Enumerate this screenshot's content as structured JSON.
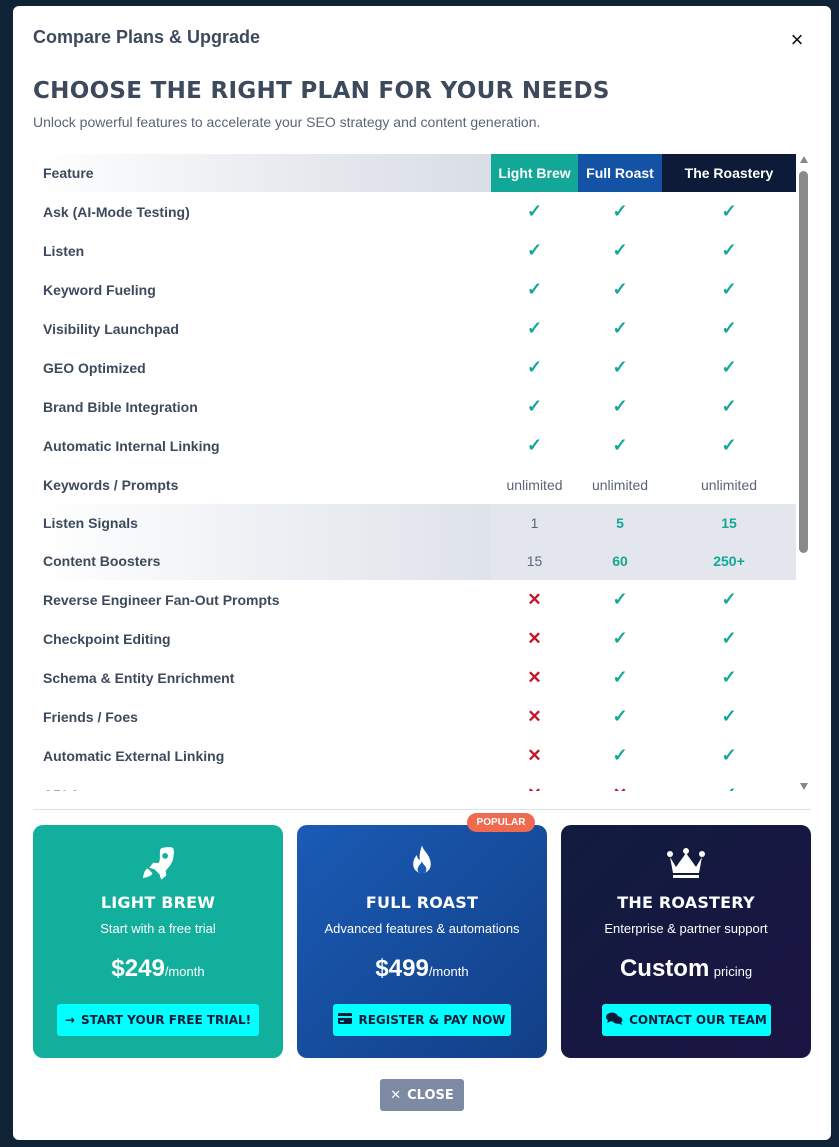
{
  "modal": {
    "title": "Compare Plans & Upgrade",
    "close_glyph": "×",
    "heading": "Choose the right plan for your needs",
    "subtitle": "Unlock powerful features to accelerate your SEO strategy and content generation."
  },
  "table": {
    "headers": {
      "feature": "Feature",
      "light_brew": "Light Brew",
      "full_roast": "Full Roast",
      "roastery": "The Roastery"
    },
    "rows": [
      {
        "feature": "Ask (AI-Mode Testing)",
        "values": [
          "check",
          "check",
          "check"
        ]
      },
      {
        "feature": "Listen",
        "values": [
          "check",
          "check",
          "check"
        ]
      },
      {
        "feature": "Keyword Fueling",
        "values": [
          "check",
          "check",
          "check"
        ]
      },
      {
        "feature": "Visibility Launchpad",
        "values": [
          "check",
          "check",
          "check"
        ]
      },
      {
        "feature": "GEO Optimized",
        "values": [
          "check",
          "check",
          "check"
        ]
      },
      {
        "feature": "Brand Bible Integration",
        "values": [
          "check",
          "check",
          "check"
        ]
      },
      {
        "feature": "Automatic Internal Linking",
        "values": [
          "check",
          "check",
          "check"
        ]
      },
      {
        "feature": "Keywords / Prompts",
        "values": [
          "unlimited",
          "unlimited",
          "unlimited"
        ]
      },
      {
        "feature": "Listen Signals",
        "values": [
          "1",
          "5",
          "15"
        ]
      },
      {
        "feature": "Content Boosters",
        "values": [
          "15",
          "60",
          "250+"
        ]
      },
      {
        "feature": "Reverse Engineer Fan-Out Prompts",
        "values": [
          "cross",
          "check",
          "check"
        ]
      },
      {
        "feature": "Checkpoint Editing",
        "values": [
          "cross",
          "check",
          "check"
        ]
      },
      {
        "feature": "Schema & Entity Enrichment",
        "values": [
          "cross",
          "check",
          "check"
        ]
      },
      {
        "feature": "Friends / Foes",
        "values": [
          "cross",
          "check",
          "check"
        ]
      },
      {
        "feature": "Automatic External Linking",
        "values": [
          "cross",
          "check",
          "check"
        ]
      },
      {
        "feature": "API Access",
        "values": [
          "cross",
          "cross",
          "check"
        ]
      }
    ],
    "check_glyph": "✓",
    "cross_glyph": "✕"
  },
  "cards": {
    "light_brew": {
      "icon": "rocket-icon",
      "name": "Light Brew",
      "desc": "Start with a free trial",
      "price": "$249",
      "price_suffix": "/month",
      "button_icon": "arrow-right-icon",
      "button_glyph": "→",
      "button": "Start your free trial!"
    },
    "full_roast": {
      "badge": "POPULAR",
      "icon": "fire-icon",
      "name": "Full Roast",
      "desc": "Advanced features & automations",
      "price": "$499",
      "price_suffix": "/month",
      "button_icon": "credit-card-icon",
      "button": "Register & Pay Now"
    },
    "roastery": {
      "icon": "crown-icon",
      "name": "The Roastery",
      "desc": "Enterprise & partner support",
      "price": "Custom",
      "price_suffix": "pricing",
      "button_icon": "chat-icon",
      "button": "Contact our team"
    }
  },
  "footer": {
    "close_icon": "close-icon",
    "close_glyph": "✕",
    "close_label": "Close"
  },
  "colors": {
    "teal": "#12a796",
    "blue": "#1452a6",
    "navy": "#0d1b38",
    "cyan_button": "#00ffff",
    "cross_red": "#c4132b",
    "badge": "#f06a4f"
  }
}
